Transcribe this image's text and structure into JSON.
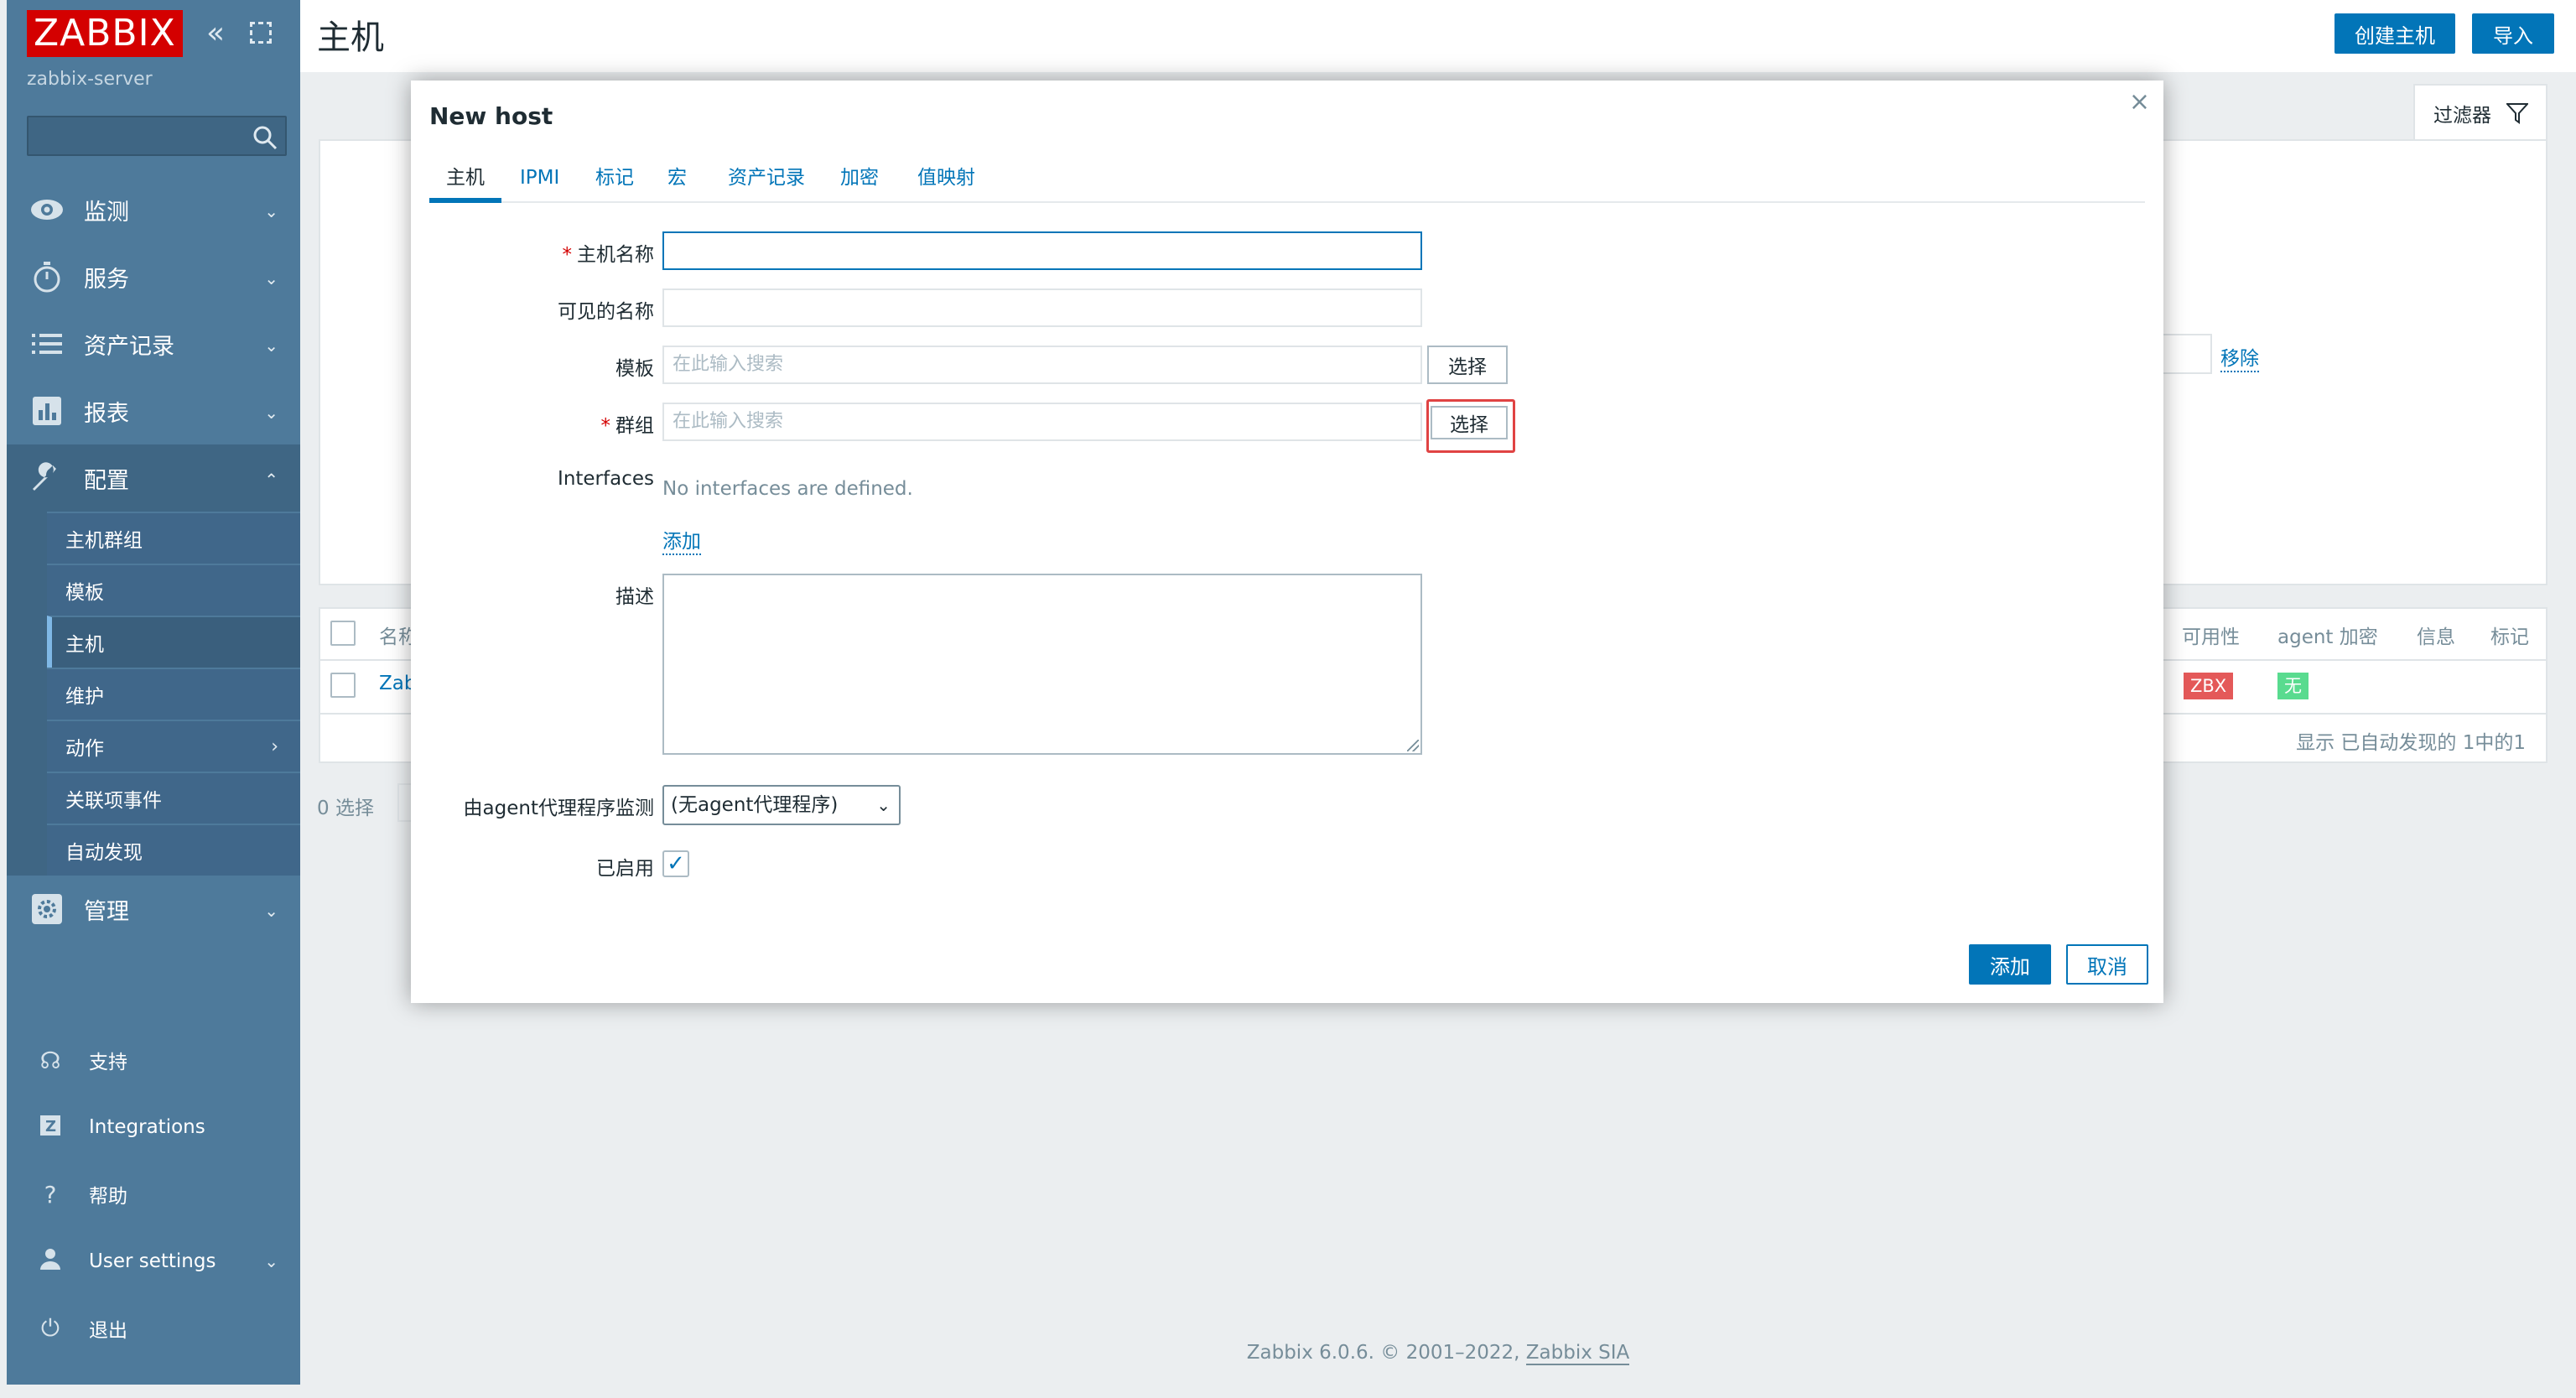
{
  "sidebar": {
    "logo": "ZABBIX",
    "server_name": "zabbix-server",
    "search_placeholder": "",
    "menu": [
      {
        "label": "监测",
        "icon": "eye-icon"
      },
      {
        "label": "服务",
        "icon": "stopwatch-icon"
      },
      {
        "label": "资产记录",
        "icon": "list-icon"
      },
      {
        "label": "报表",
        "icon": "bar-chart-icon"
      },
      {
        "label": "配置",
        "icon": "wrench-icon"
      }
    ],
    "config_submenu": [
      "主机群组",
      "模板",
      "主机",
      "维护",
      "动作",
      "关联项事件",
      "自动发现"
    ],
    "admin_label": "管理",
    "bottom": [
      "支持",
      "Integrations",
      "帮助",
      "User settings",
      "退出"
    ]
  },
  "header": {
    "title": "主机",
    "create_host": "创建主机",
    "import": "导入"
  },
  "background": {
    "filter_tab": "过滤器",
    "remove": "移除",
    "columns": {
      "name": "名称",
      "availability": "可用性",
      "agent_encryption": "agent 加密",
      "info": "信息",
      "tags": "标记"
    },
    "row_name": "Zab",
    "badge_zbx": "ZBX",
    "badge_none": "无",
    "footer_text": "显示 已自动发现的 1中的1",
    "selected": "0 选择"
  },
  "modal": {
    "title": "New host",
    "tabs": [
      "主机",
      "IPMI",
      "标记",
      "宏",
      "资产记录",
      "加密",
      "值映射"
    ],
    "labels": {
      "host_name": "主机名称",
      "visible_name": "可见的名称",
      "templates": "模板",
      "groups": "群组",
      "interfaces": "Interfaces",
      "description": "描述",
      "proxy": "由agent代理程序监测",
      "enabled": "已启用"
    },
    "search_placeholder": "在此输入搜索",
    "select_button": "选择",
    "no_interfaces": "No interfaces are defined.",
    "add_link": "添加",
    "proxy_value": "(无agent代理程序)",
    "enabled_checked": true,
    "add_button": "添加",
    "cancel_button": "取消"
  },
  "footer": {
    "version": "Zabbix 6.0.6. © 2001–2022,",
    "company": "Zabbix SIA"
  },
  "colors": {
    "sidebar": "#4e7a9b",
    "accent": "#0275b8",
    "logo": "#d40000",
    "badge_red": "#e45959",
    "badge_green": "#59db8f"
  }
}
